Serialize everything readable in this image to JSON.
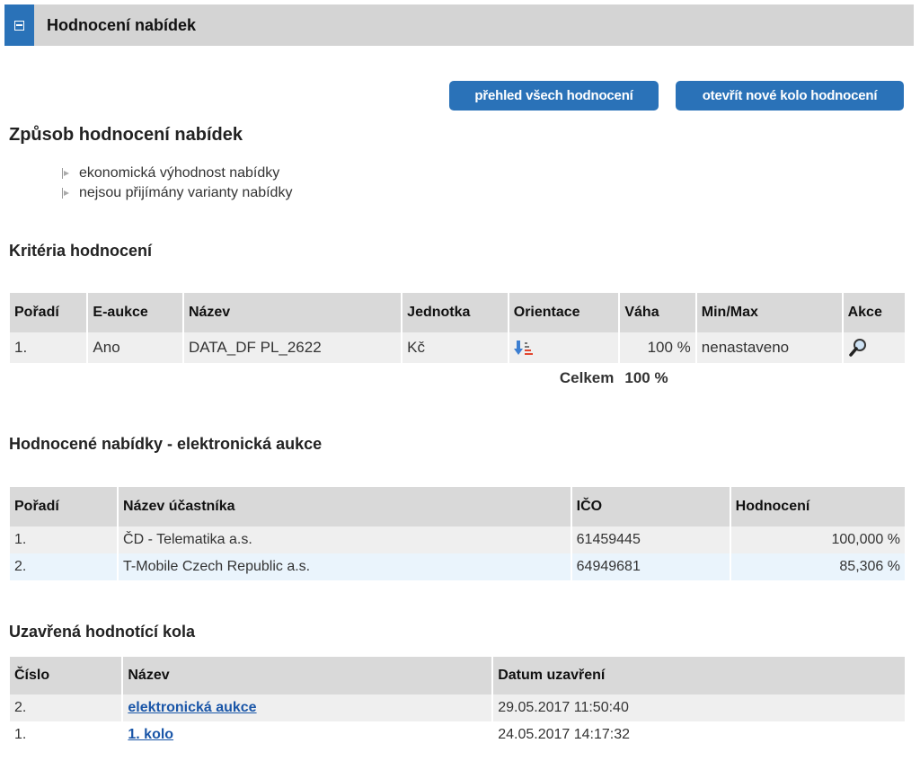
{
  "header": {
    "title": "Hodnocení nabídek"
  },
  "buttons": {
    "overview": "přehled všech hodnocení",
    "new_round": "otevřít nové kolo hodnocení"
  },
  "method": {
    "title": "Způsob hodnocení nabídek",
    "items": [
      "ekonomická výhodnost nabídky",
      "nejsou přijímány varianty nabídky"
    ]
  },
  "criteria": {
    "title": "Kritéria hodnocení",
    "columns": [
      "Pořadí",
      "E-aukce",
      "Název",
      "Jednotka",
      "Orientace",
      "Váha",
      "Min/Max",
      "Akce"
    ],
    "rows": [
      {
        "order": "1.",
        "eauction": "Ano",
        "name": "DATA_DF PL_2622",
        "unit": "Kč",
        "orientation_icon": "sort-descending-icon",
        "weight": "100 %",
        "minmax": "nenastaveno",
        "action_icon": "magnifier-icon"
      }
    ],
    "total_label": "Celkem",
    "total_value": "100 %"
  },
  "offers": {
    "title": "Hodnocené nabídky - elektronická aukce",
    "columns": [
      "Pořadí",
      "Název účastníka",
      "IČO",
      "Hodnocení"
    ],
    "rows": [
      {
        "order": "1.",
        "name": "ČD - Telematika a.s.",
        "ico": "61459445",
        "score": "100,000 %"
      },
      {
        "order": "2.",
        "name": "T-Mobile Czech Republic a.s.",
        "ico": "64949681",
        "score": "85,306 %"
      }
    ]
  },
  "rounds": {
    "title": "Uzavřená hodnotící kola",
    "columns": [
      "Číslo",
      "Název",
      "Datum uzavření"
    ],
    "rows": [
      {
        "number": "2.",
        "name": "elektronická aukce",
        "date": "29.05.2017 11:50:40"
      },
      {
        "number": "1.",
        "name": "1. kolo",
        "date": "24.05.2017 14:17:32"
      }
    ]
  },
  "colors": {
    "accent": "#2a72b8",
    "header_bg": "#d4d4d4",
    "link": "#1a56a8"
  }
}
